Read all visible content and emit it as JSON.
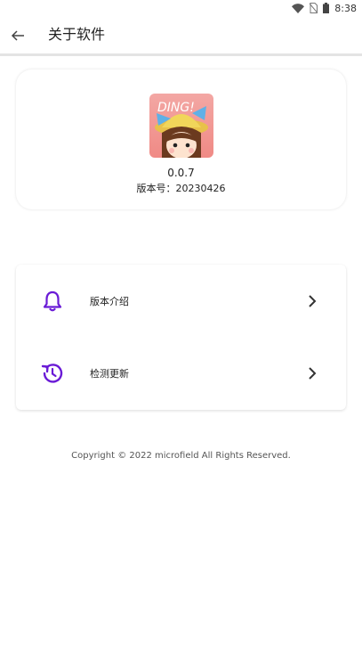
{
  "status_bar": {
    "time": "8:38"
  },
  "header": {
    "title": "关于软件"
  },
  "app_info": {
    "version": "0.0.7",
    "build": "版本号：20230426",
    "icon_text": "DING!"
  },
  "menu": {
    "items": [
      {
        "label": "版本介绍",
        "icon": "bell-icon"
      },
      {
        "label": "检测更新",
        "icon": "refresh-clock-icon"
      }
    ]
  },
  "footer": {
    "copyright": "Copyright © 2022 microfield All Rights Reserved."
  },
  "colors": {
    "accent": "#6a1bd6",
    "divider": "#e4e4e4"
  }
}
